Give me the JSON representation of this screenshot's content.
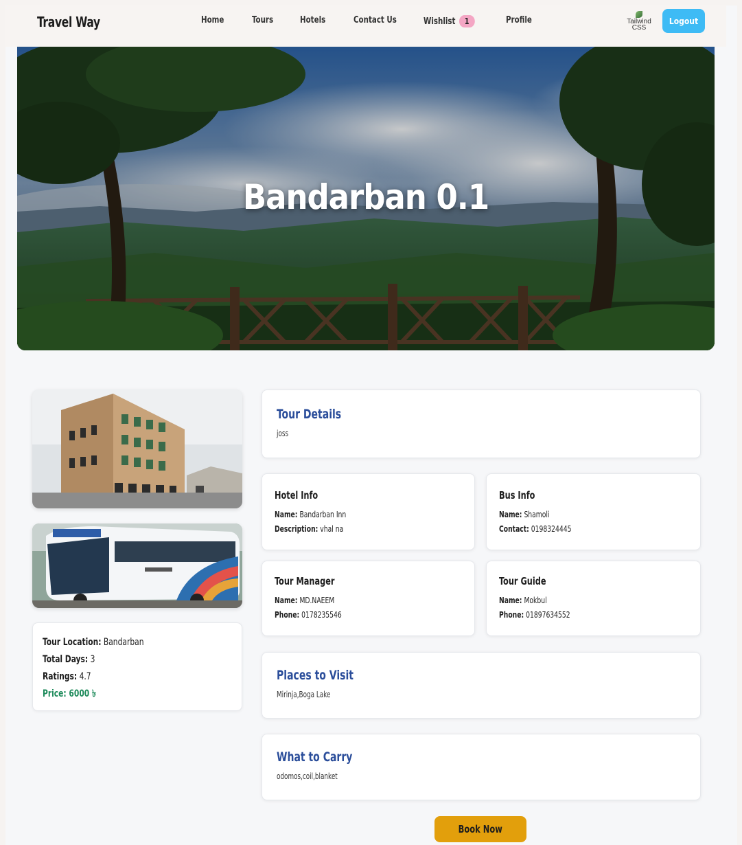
{
  "navbar": {
    "brand": "Travel Way",
    "links": {
      "home": "Home",
      "tours": "Tours",
      "hotels": "Hotels",
      "contact": "Contact Us",
      "wishlist": "Wishlist",
      "profile": "Profile"
    },
    "wishlist_count": "1",
    "avatar_text": "Tailwind CSS",
    "logout_label": "Logout"
  },
  "hero": {
    "title": "Bandarban 0.1"
  },
  "summary": {
    "location_label": "Tour Location:",
    "location_value": "Bandarban",
    "days_label": "Total Days:",
    "days_value": "3",
    "ratings_label": "Ratings:",
    "ratings_value": "4.7",
    "price_label": "Price:",
    "price_value": "6000 ৳"
  },
  "tour_details": {
    "title": "Tour Details",
    "text": "joss"
  },
  "hotel_info": {
    "title": "Hotel Info",
    "name_label": "Name:",
    "name_value": "Bandarban Inn",
    "desc_label": "Description:",
    "desc_value": "vhal na"
  },
  "bus_info": {
    "title": "Bus Info",
    "name_label": "Name:",
    "name_value": "Shamoli",
    "contact_label": "Contact:",
    "contact_value": "0198324445"
  },
  "tour_manager": {
    "title": "Tour Manager",
    "name_label": "Name:",
    "name_value": "MD.NAEEM",
    "phone_label": "Phone:",
    "phone_value": "0178235546"
  },
  "tour_guide": {
    "title": "Tour Guide",
    "name_label": "Name:",
    "name_value": "Mokbul",
    "phone_label": "Phone:",
    "phone_value": "01897634552"
  },
  "places": {
    "title": "Places to Visit",
    "text": "Mirinja,Boga Lake"
  },
  "carry": {
    "title": "What to Carry",
    "text": "odomos,coil,blanket"
  },
  "book_label": "Book Now",
  "colors": {
    "logout_bg": "#3ebbf5",
    "wishlist_badge": "#f4a6c4",
    "card_title_blue": "#2a4d9a",
    "price_green": "#1c8a5a",
    "book_button": "#e29f0c"
  }
}
